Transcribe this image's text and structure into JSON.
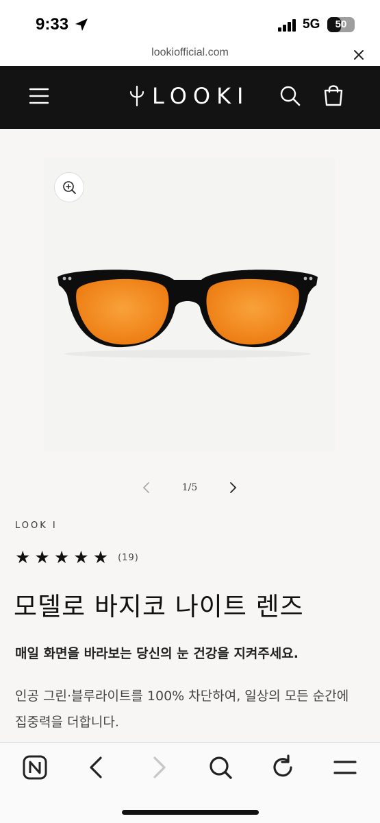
{
  "status_bar": {
    "time": "9:33",
    "network": "5G",
    "battery_level": "50",
    "battery_fraction": 0.5,
    "location_icon": "location-arrow-icon",
    "signal_icon": "cellular-signal-icon"
  },
  "browser": {
    "url": "lookiofficial.com",
    "close_icon": "close-icon"
  },
  "header": {
    "brand": "LOOKI",
    "menu_icon": "hamburger-menu-icon",
    "search_icon": "search-icon",
    "cart_icon": "cart-icon",
    "background": "#131313"
  },
  "gallery": {
    "zoom_icon": "zoom-in-icon",
    "image_subject": "orange-lens-glasses",
    "pager": "1/5",
    "lens_color": "#f48a1c"
  },
  "product": {
    "vendor": "LOOK I",
    "rating_stars": 5,
    "review_count": "(19)",
    "title": "모델로 바지코 나이트 렌즈",
    "tagline": "매일 화면을 바라보는 당신의 눈 건강을 지켜주세요.",
    "description": "인공 그린·블루라이트를 100% 차단하여, 일상의 모든 순간에 집중력을 더합니다."
  },
  "toolbar": {
    "items": [
      "naver-home-icon",
      "back-icon",
      "forward-icon",
      "search-icon",
      "reload-icon",
      "menu-icon"
    ]
  }
}
